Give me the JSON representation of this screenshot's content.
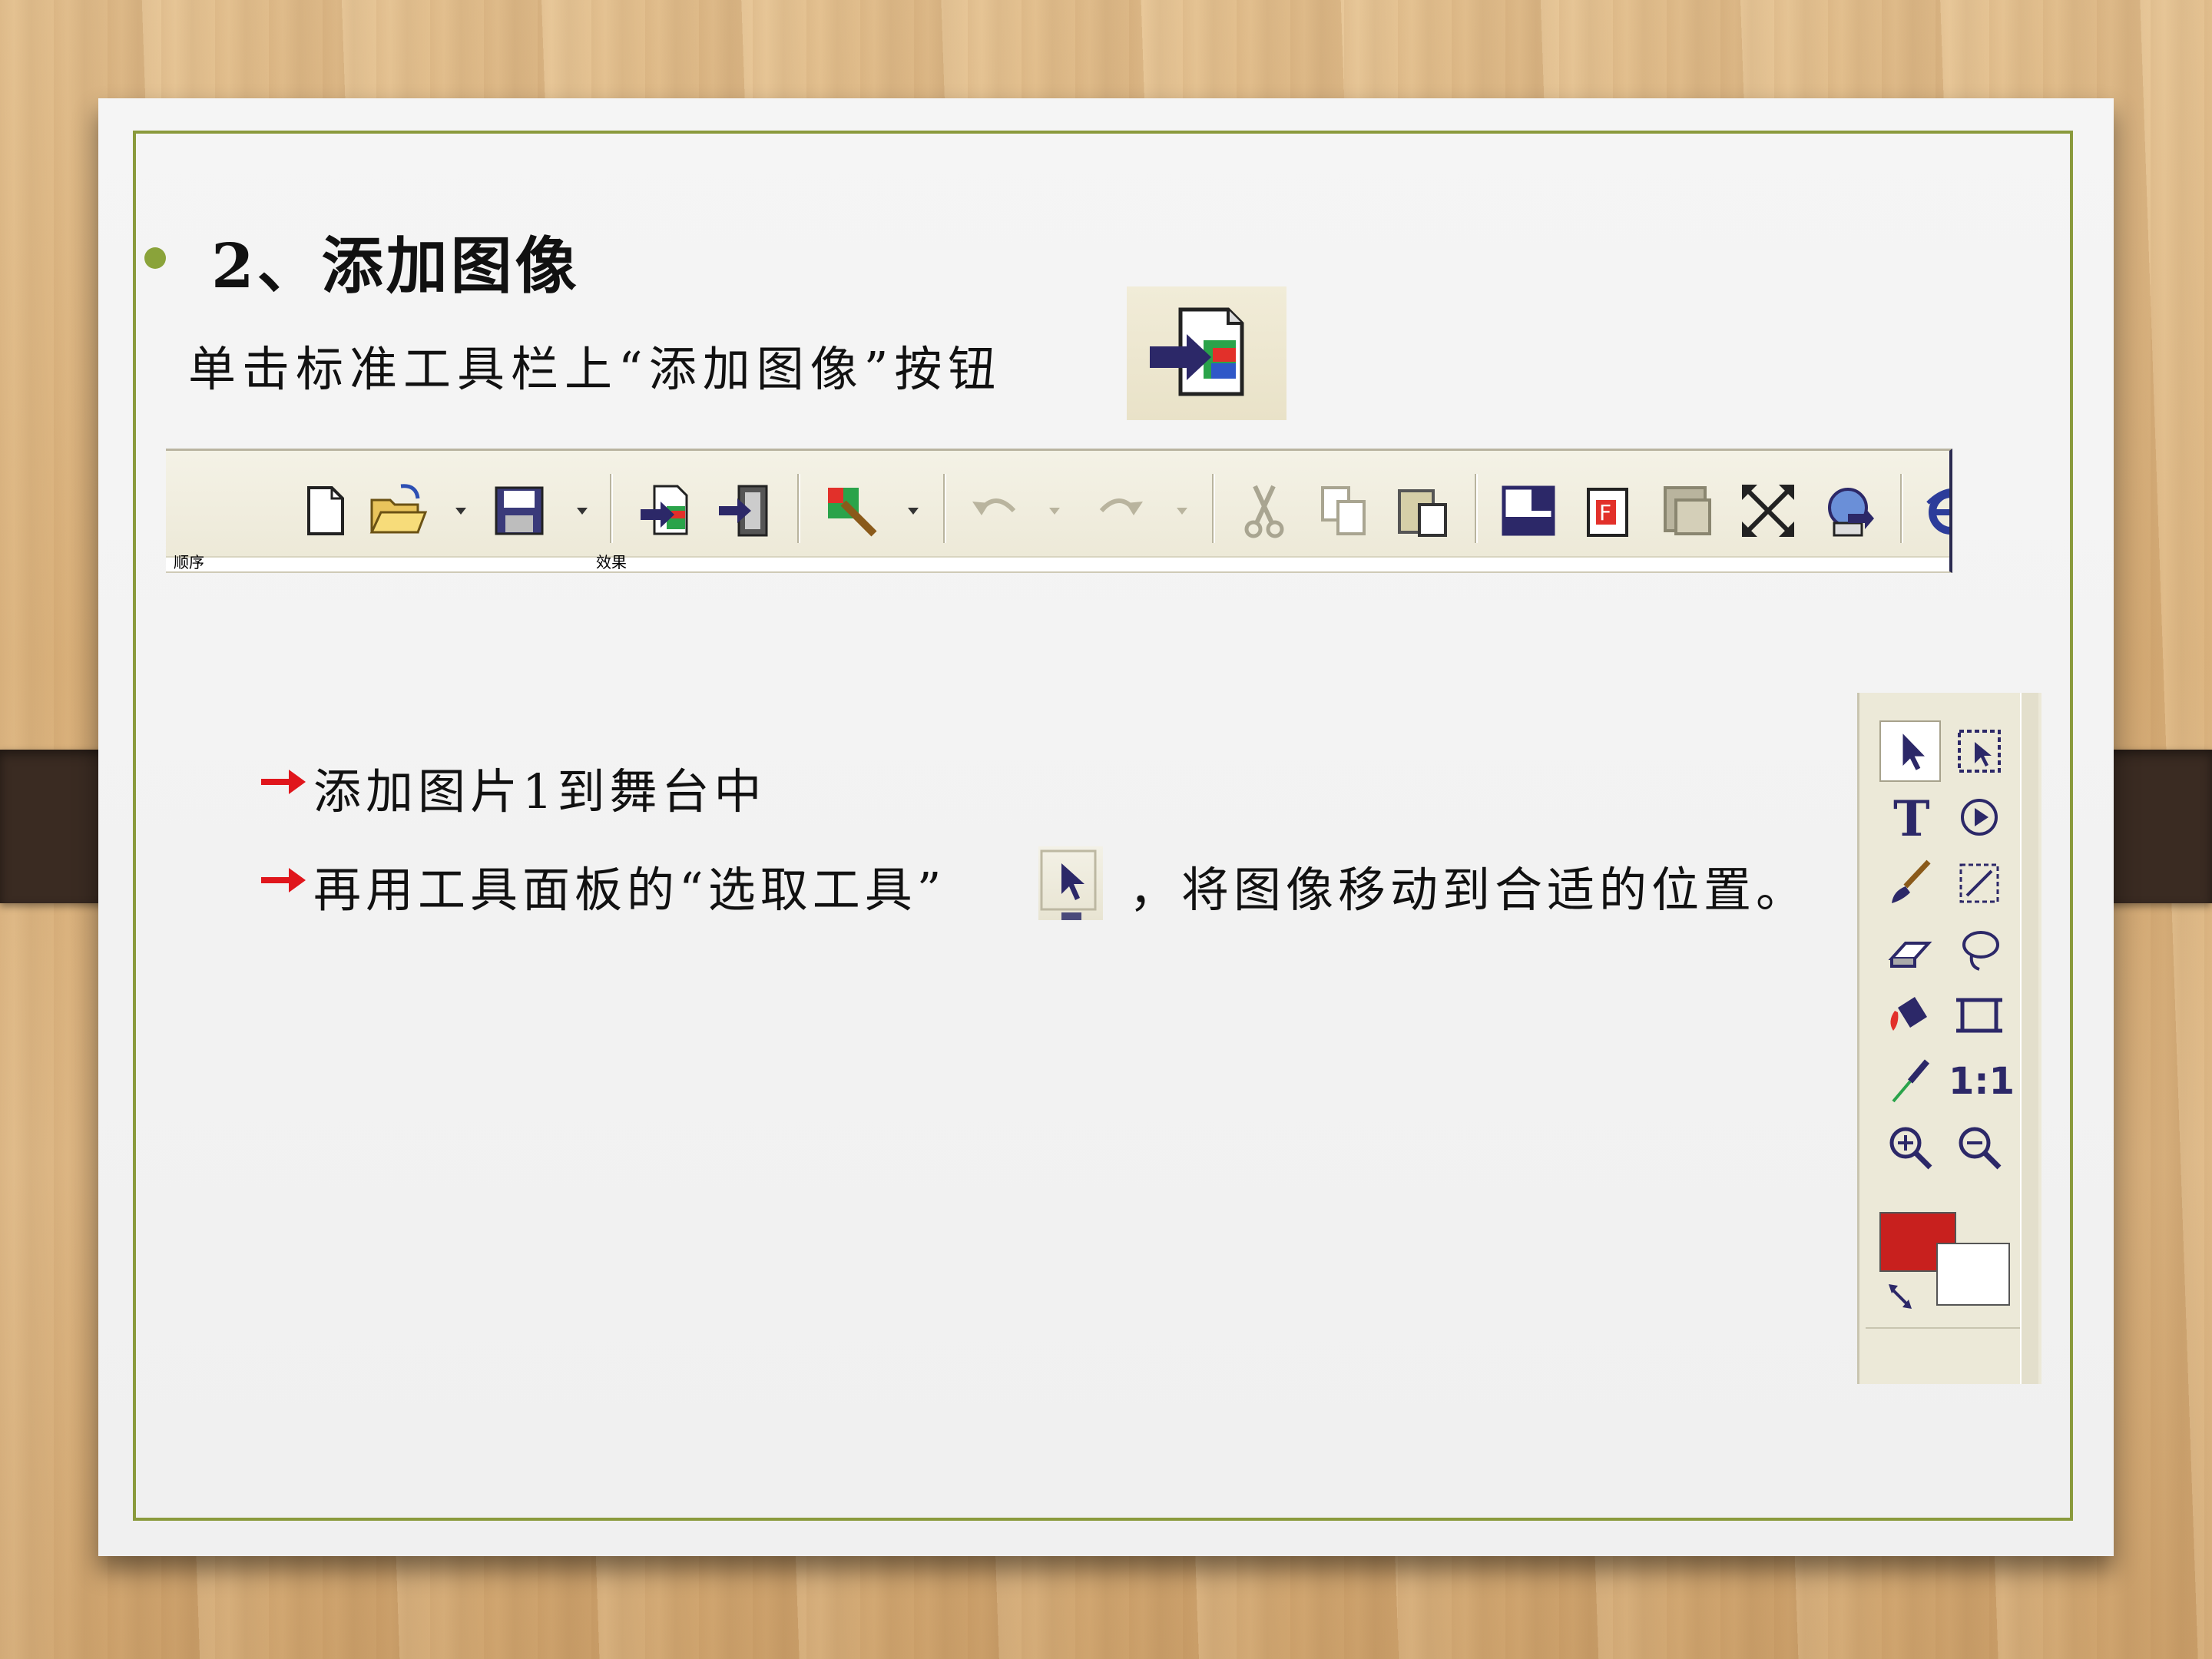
{
  "slide": {
    "heading": "2、添加图像",
    "subline": "单击标准工具栏上“添加图像”按钮",
    "line1": "添加图片1到舞台中",
    "line2_before": "再用工具面板的“选取工具”",
    "line2_after": "，将图像移动到合适的位置。",
    "toolbar_sub_left": "顺序",
    "toolbar_sub_right": "效果"
  },
  "colors": {
    "accent": "#8aa33a",
    "frame": "#8a9a3c",
    "arrow": "#e0161c",
    "stroke_color": "#c8201e",
    "fill_color": "#ffffff"
  },
  "toolbar": {
    "icons": [
      "new-file-icon",
      "open-folder-icon",
      "save-icon",
      "add-image-icon",
      "add-movie-icon",
      "paint-brush-icon",
      "undo-icon",
      "redo-icon",
      "cut-icon",
      "copy-icon",
      "paste-icon",
      "stage-icon",
      "transition-icon",
      "effect-icon",
      "fit-icon",
      "publish-icon",
      "ie-preview-icon",
      "more-icon"
    ]
  },
  "tool_panel": {
    "icons": [
      "select-tool-icon",
      "subselect-tool-icon",
      "text-tool-icon",
      "play-tool-icon",
      "brush-tool-icon",
      "transform-tool-icon",
      "eraser-tool-icon",
      "lasso-tool-icon",
      "fill-tool-icon",
      "crop-tool-icon",
      "eyedropper-tool-icon",
      "actual-size-icon",
      "zoom-in-icon",
      "zoom-out-icon"
    ],
    "actual_size_label": "1:1"
  }
}
